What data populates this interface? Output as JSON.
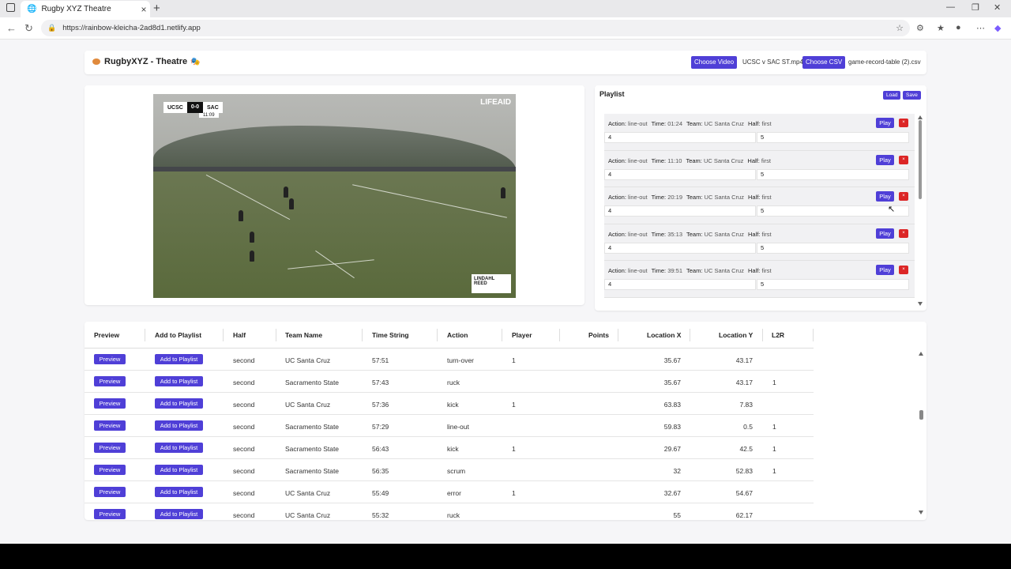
{
  "browser": {
    "tab_title": "Rugby XYZ Theatre",
    "url": "https://rainbow-kleicha-2ad8d1.netlify.app",
    "tab_close": "×",
    "new_tab": "+"
  },
  "header": {
    "brand": "RugbyXYZ - Theatre",
    "choose_video_label": "Choose Video",
    "video_file": "UCSC v SAC ST.mp4",
    "choose_csv_label": "Choose CSV",
    "csv_file": "game-record-table (2).csv"
  },
  "video": {
    "home_team": "UCSC",
    "score": "0-0",
    "away_team": "SAC",
    "clock": "11:09",
    "logo_top": "LIFEAID",
    "logo_bottom": "LINDAHL REED"
  },
  "playlist": {
    "title": "Playlist",
    "load_label": "Load",
    "save_label": "Save",
    "play_label": "Play",
    "remove_label": "×",
    "key_action": "Action:",
    "key_time": "Time:",
    "key_team": "Team:",
    "key_half": "Half:",
    "items": [
      {
        "action": "line-out",
        "time": "01:24",
        "team": "UC Santa Cruz",
        "half": "first",
        "start": "4",
        "end": "5"
      },
      {
        "action": "line-out",
        "time": "11:10",
        "team": "UC Santa Cruz",
        "half": "first",
        "start": "4",
        "end": "5"
      },
      {
        "action": "line-out",
        "time": "20:19",
        "team": "UC Santa Cruz",
        "half": "first",
        "start": "4",
        "end": "5"
      },
      {
        "action": "line-out",
        "time": "35:13",
        "team": "UC Santa Cruz",
        "half": "first",
        "start": "4",
        "end": "5"
      },
      {
        "action": "line-out",
        "time": "39:51",
        "team": "UC Santa Cruz",
        "half": "first",
        "start": "4",
        "end": "5"
      }
    ]
  },
  "table": {
    "headers": {
      "preview": "Preview",
      "add": "Add to Playlist",
      "half": "Half",
      "team": "Team Name",
      "time": "Time String",
      "action": "Action",
      "player": "Player",
      "points": "Points",
      "locx": "Location X",
      "locy": "Location Y",
      "l2r": "L2R"
    },
    "preview_label": "Preview",
    "add_label": "Add to Playlist",
    "rows": [
      {
        "half": "second",
        "team": "UC Santa Cruz",
        "time": "57:51",
        "action": "turn-over",
        "player": "1",
        "points": "",
        "x": "35.67",
        "y": "43.17",
        "l2r": ""
      },
      {
        "half": "second",
        "team": "Sacramento State",
        "time": "57:43",
        "action": "ruck",
        "player": "",
        "points": "",
        "x": "35.67",
        "y": "43.17",
        "l2r": "1"
      },
      {
        "half": "second",
        "team": "UC Santa Cruz",
        "time": "57:36",
        "action": "kick",
        "player": "1",
        "points": "",
        "x": "63.83",
        "y": "7.83",
        "l2r": ""
      },
      {
        "half": "second",
        "team": "Sacramento State",
        "time": "57:29",
        "action": "line-out",
        "player": "",
        "points": "",
        "x": "59.83",
        "y": "0.5",
        "l2r": "1"
      },
      {
        "half": "second",
        "team": "Sacramento State",
        "time": "56:43",
        "action": "kick",
        "player": "1",
        "points": "",
        "x": "29.67",
        "y": "42.5",
        "l2r": "1"
      },
      {
        "half": "second",
        "team": "Sacramento State",
        "time": "56:35",
        "action": "scrum",
        "player": "",
        "points": "",
        "x": "32",
        "y": "52.83",
        "l2r": "1"
      },
      {
        "half": "second",
        "team": "UC Santa Cruz",
        "time": "55:49",
        "action": "error",
        "player": "1",
        "points": "",
        "x": "32.67",
        "y": "54.67",
        "l2r": ""
      },
      {
        "half": "second",
        "team": "UC Santa Cruz",
        "time": "55:32",
        "action": "ruck",
        "player": "",
        "points": "",
        "x": "55",
        "y": "62.17",
        "l2r": ""
      }
    ]
  }
}
